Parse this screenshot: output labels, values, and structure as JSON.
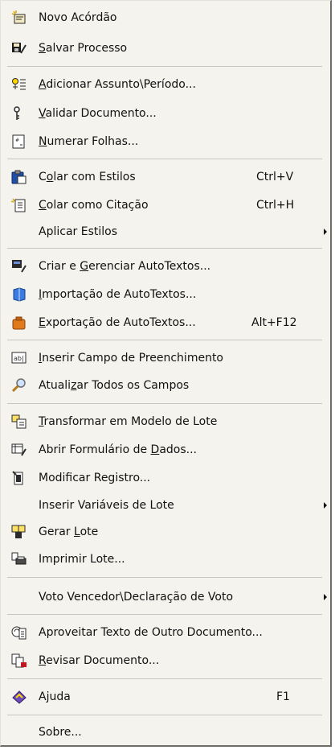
{
  "menu": {
    "items": [
      {
        "id": "novo-acordao",
        "parts": [
          "Novo Acórdão"
        ],
        "ul": [],
        "icon": "new-document-icon"
      },
      {
        "id": "salvar-processo",
        "parts": [
          "",
          "S",
          "alvar Processo"
        ],
        "icon": "save-process-icon"
      },
      {
        "id": "adicionar-assunto",
        "parts": [
          "",
          "A",
          "dicionar Assunto\\Período..."
        ],
        "icon": "add-subject-icon"
      },
      {
        "id": "validar-documento",
        "parts": [
          "",
          "V",
          "alidar Documento..."
        ],
        "icon": "validate-key-icon"
      },
      {
        "id": "numerar-folhas",
        "parts": [
          "",
          "N",
          "umerar Folhas..."
        ],
        "icon": "number-pages-icon"
      },
      {
        "id": "colar-estilos",
        "parts": [
          "C",
          "o",
          "lar com Estilos"
        ],
        "icon": "paste-styles-icon",
        "shortcut": "Ctrl+V"
      },
      {
        "id": "colar-citacao",
        "parts": [
          "",
          "C",
          "olar como Citação"
        ],
        "icon": "paste-quote-icon",
        "shortcut": "Ctrl+H"
      },
      {
        "id": "aplicar-estilos",
        "parts": [
          "Aplicar Estilos"
        ],
        "submenu": true
      },
      {
        "id": "criar-autotextos",
        "parts": [
          "Criar e ",
          "G",
          "erenciar AutoTextos..."
        ],
        "icon": "autotext-manage-icon"
      },
      {
        "id": "importacao-autotextos",
        "parts": [
          "",
          "I",
          "mportação de AutoTextos..."
        ],
        "icon": "import-autotext-icon"
      },
      {
        "id": "exportacao-autotextos",
        "parts": [
          "",
          "E",
          "xportação de AutoTextos..."
        ],
        "icon": "export-autotext-icon",
        "shortcut": "Alt+F12"
      },
      {
        "id": "inserir-campo",
        "parts": [
          "",
          "I",
          "nserir Campo de Preenchimento"
        ],
        "icon": "text-field-icon"
      },
      {
        "id": "atualizar-campos",
        "parts": [
          "Atuali",
          "z",
          "ar Todos os Campos"
        ],
        "icon": "magnifier-icon"
      },
      {
        "id": "transformar-modelo",
        "parts": [
          "",
          "T",
          "ransformar em Modelo de Lote"
        ],
        "icon": "batch-template-icon"
      },
      {
        "id": "abrir-formulario",
        "parts": [
          "Abrir Formulário de ",
          "D",
          "ados..."
        ],
        "icon": "data-form-icon"
      },
      {
        "id": "modificar-registro",
        "parts": [
          "Modificar Registro..."
        ],
        "icon": "modify-record-icon"
      },
      {
        "id": "inserir-variaveis",
        "parts": [
          "Inserir Variáveis de Lote"
        ],
        "submenu": true
      },
      {
        "id": "gerar-lote",
        "parts": [
          "Gerar ",
          "L",
          "ote"
        ],
        "icon": "generate-batch-icon"
      },
      {
        "id": "imprimir-lote",
        "parts": [
          "Imprimir Lote..."
        ],
        "icon": "print-batch-icon"
      },
      {
        "id": "voto-vencedor",
        "parts": [
          "Voto Vencedor\\Declaração de Voto"
        ],
        "submenu": true
      },
      {
        "id": "aproveitar-texto",
        "parts": [
          "Aproveitar Texto de Outro Documento..."
        ],
        "icon": "reuse-text-icon"
      },
      {
        "id": "revisar-documento",
        "parts": [
          "",
          "R",
          "evisar Documento..."
        ],
        "icon": "review-document-icon"
      },
      {
        "id": "ajuda",
        "parts": [
          "A",
          "j",
          "uda"
        ],
        "icon": "help-book-icon",
        "shortcut": "F1"
      },
      {
        "id": "sobre",
        "parts": [
          "Sobre..."
        ]
      }
    ]
  },
  "colors": {
    "menu_bg": "#f4f3ee",
    "separator": "#c8c6bd",
    "text": "#111111"
  }
}
